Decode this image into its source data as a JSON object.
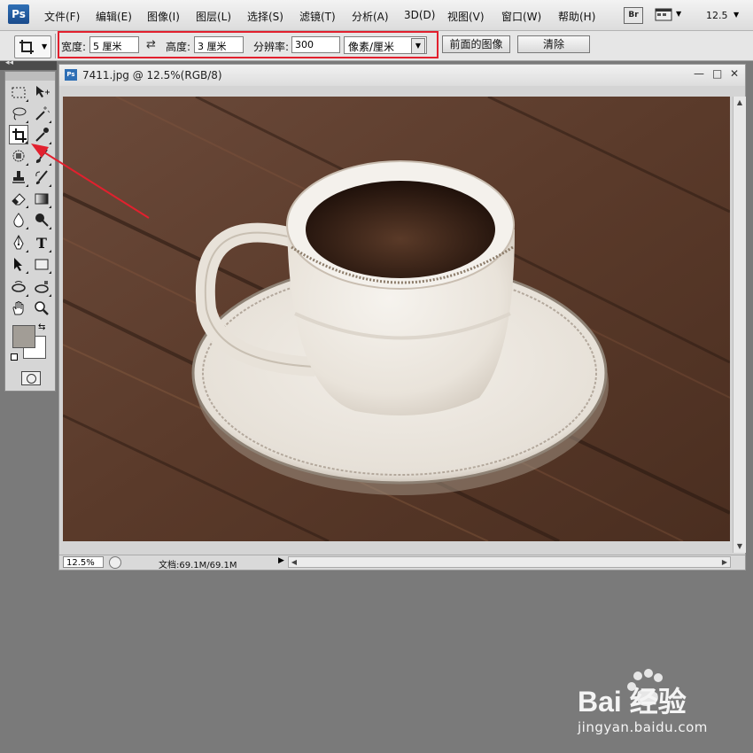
{
  "app": {
    "logo_text": "Ps"
  },
  "menubar": {
    "items": [
      "文件(F)",
      "编辑(E)",
      "图像(I)",
      "图层(L)",
      "选择(S)",
      "滤镜(T)",
      "分析(A)",
      "3D(D)",
      "视图(V)",
      "窗口(W)",
      "帮助(H)"
    ],
    "bridge_label": "Br",
    "zoom_value": "12.5"
  },
  "options": {
    "width_label": "宽度:",
    "width_value": "5 厘米",
    "height_label": "高度:",
    "height_value": "3 厘米",
    "resolution_label": "分辨率:",
    "resolution_value": "300",
    "resolution_unit": "像素/厘米",
    "front_image_button": "前面的图像",
    "clear_button": "清除",
    "highlight_color": "#e2202e"
  },
  "tools": {
    "active_tool": "crop-tool",
    "foreground_color": "#a29d96",
    "background_color": "#ffffff",
    "text_tool_glyph": "T"
  },
  "document": {
    "title": "7411.jpg @ 12.5%(RGB/8)",
    "ps_icon_text": "Ps",
    "zoom_field": "12.5%",
    "doc_info": "文档:69.1M/69.1M"
  },
  "watermark": {
    "logo_text": "Bai 经验",
    "url": "jingyan.baidu.com"
  }
}
